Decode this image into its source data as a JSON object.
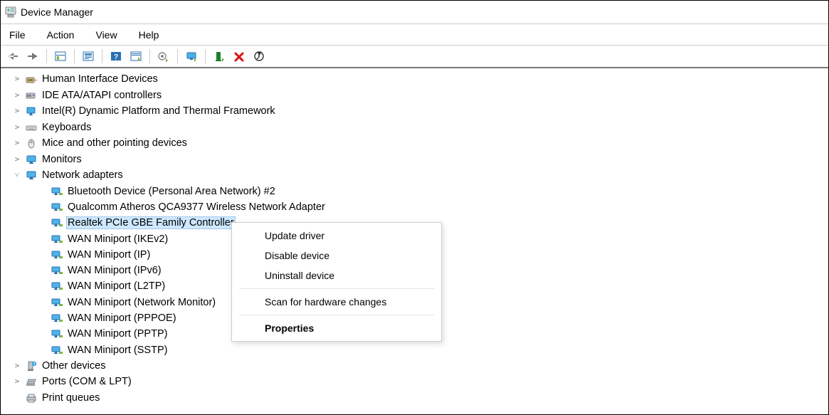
{
  "window": {
    "title": "Device Manager"
  },
  "menu": {
    "file": "File",
    "action": "Action",
    "view": "View",
    "help": "Help"
  },
  "tree": {
    "categories": [
      {
        "key": "hid",
        "label": "Human Interface Devices",
        "expanded": false,
        "last": false
      },
      {
        "key": "ide",
        "label": "IDE ATA/ATAPI controllers",
        "expanded": false,
        "last": false
      },
      {
        "key": "intel",
        "label": "Intel(R) Dynamic Platform and Thermal Framework",
        "expanded": false,
        "last": false
      },
      {
        "key": "keyboards",
        "label": "Keyboards",
        "expanded": false,
        "last": false
      },
      {
        "key": "mice",
        "label": "Mice and other pointing devices",
        "expanded": false,
        "last": false
      },
      {
        "key": "monitors",
        "label": "Monitors",
        "expanded": false,
        "last": false
      },
      {
        "key": "network",
        "label": "Network adapters",
        "expanded": true,
        "last": false
      },
      {
        "key": "other",
        "label": "Other devices",
        "expanded": false,
        "last": false
      },
      {
        "key": "ports",
        "label": "Ports (COM & LPT)",
        "expanded": false,
        "last": false
      },
      {
        "key": "printq",
        "label": "Print queues",
        "expanded": false,
        "last": true
      }
    ],
    "network_children": [
      {
        "label": "Bluetooth Device (Personal Area Network) #2",
        "selected": false
      },
      {
        "label": "Qualcomm Atheros QCA9377 Wireless Network Adapter",
        "selected": false
      },
      {
        "label": "Realtek PCIe GBE Family Controller",
        "selected": true
      },
      {
        "label": "WAN Miniport (IKEv2)",
        "selected": false
      },
      {
        "label": "WAN Miniport (IP)",
        "selected": false
      },
      {
        "label": "WAN Miniport (IPv6)",
        "selected": false
      },
      {
        "label": "WAN Miniport (L2TP)",
        "selected": false
      },
      {
        "label": "WAN Miniport (Network Monitor)",
        "selected": false
      },
      {
        "label": "WAN Miniport (PPPOE)",
        "selected": false
      },
      {
        "label": "WAN Miniport (PPTP)",
        "selected": false
      },
      {
        "label": "WAN Miniport (SSTP)",
        "selected": false
      }
    ]
  },
  "context_menu": {
    "update": "Update driver",
    "disable": "Disable device",
    "uninstall": "Uninstall device",
    "scan": "Scan for hardware changes",
    "properties": "Properties"
  }
}
